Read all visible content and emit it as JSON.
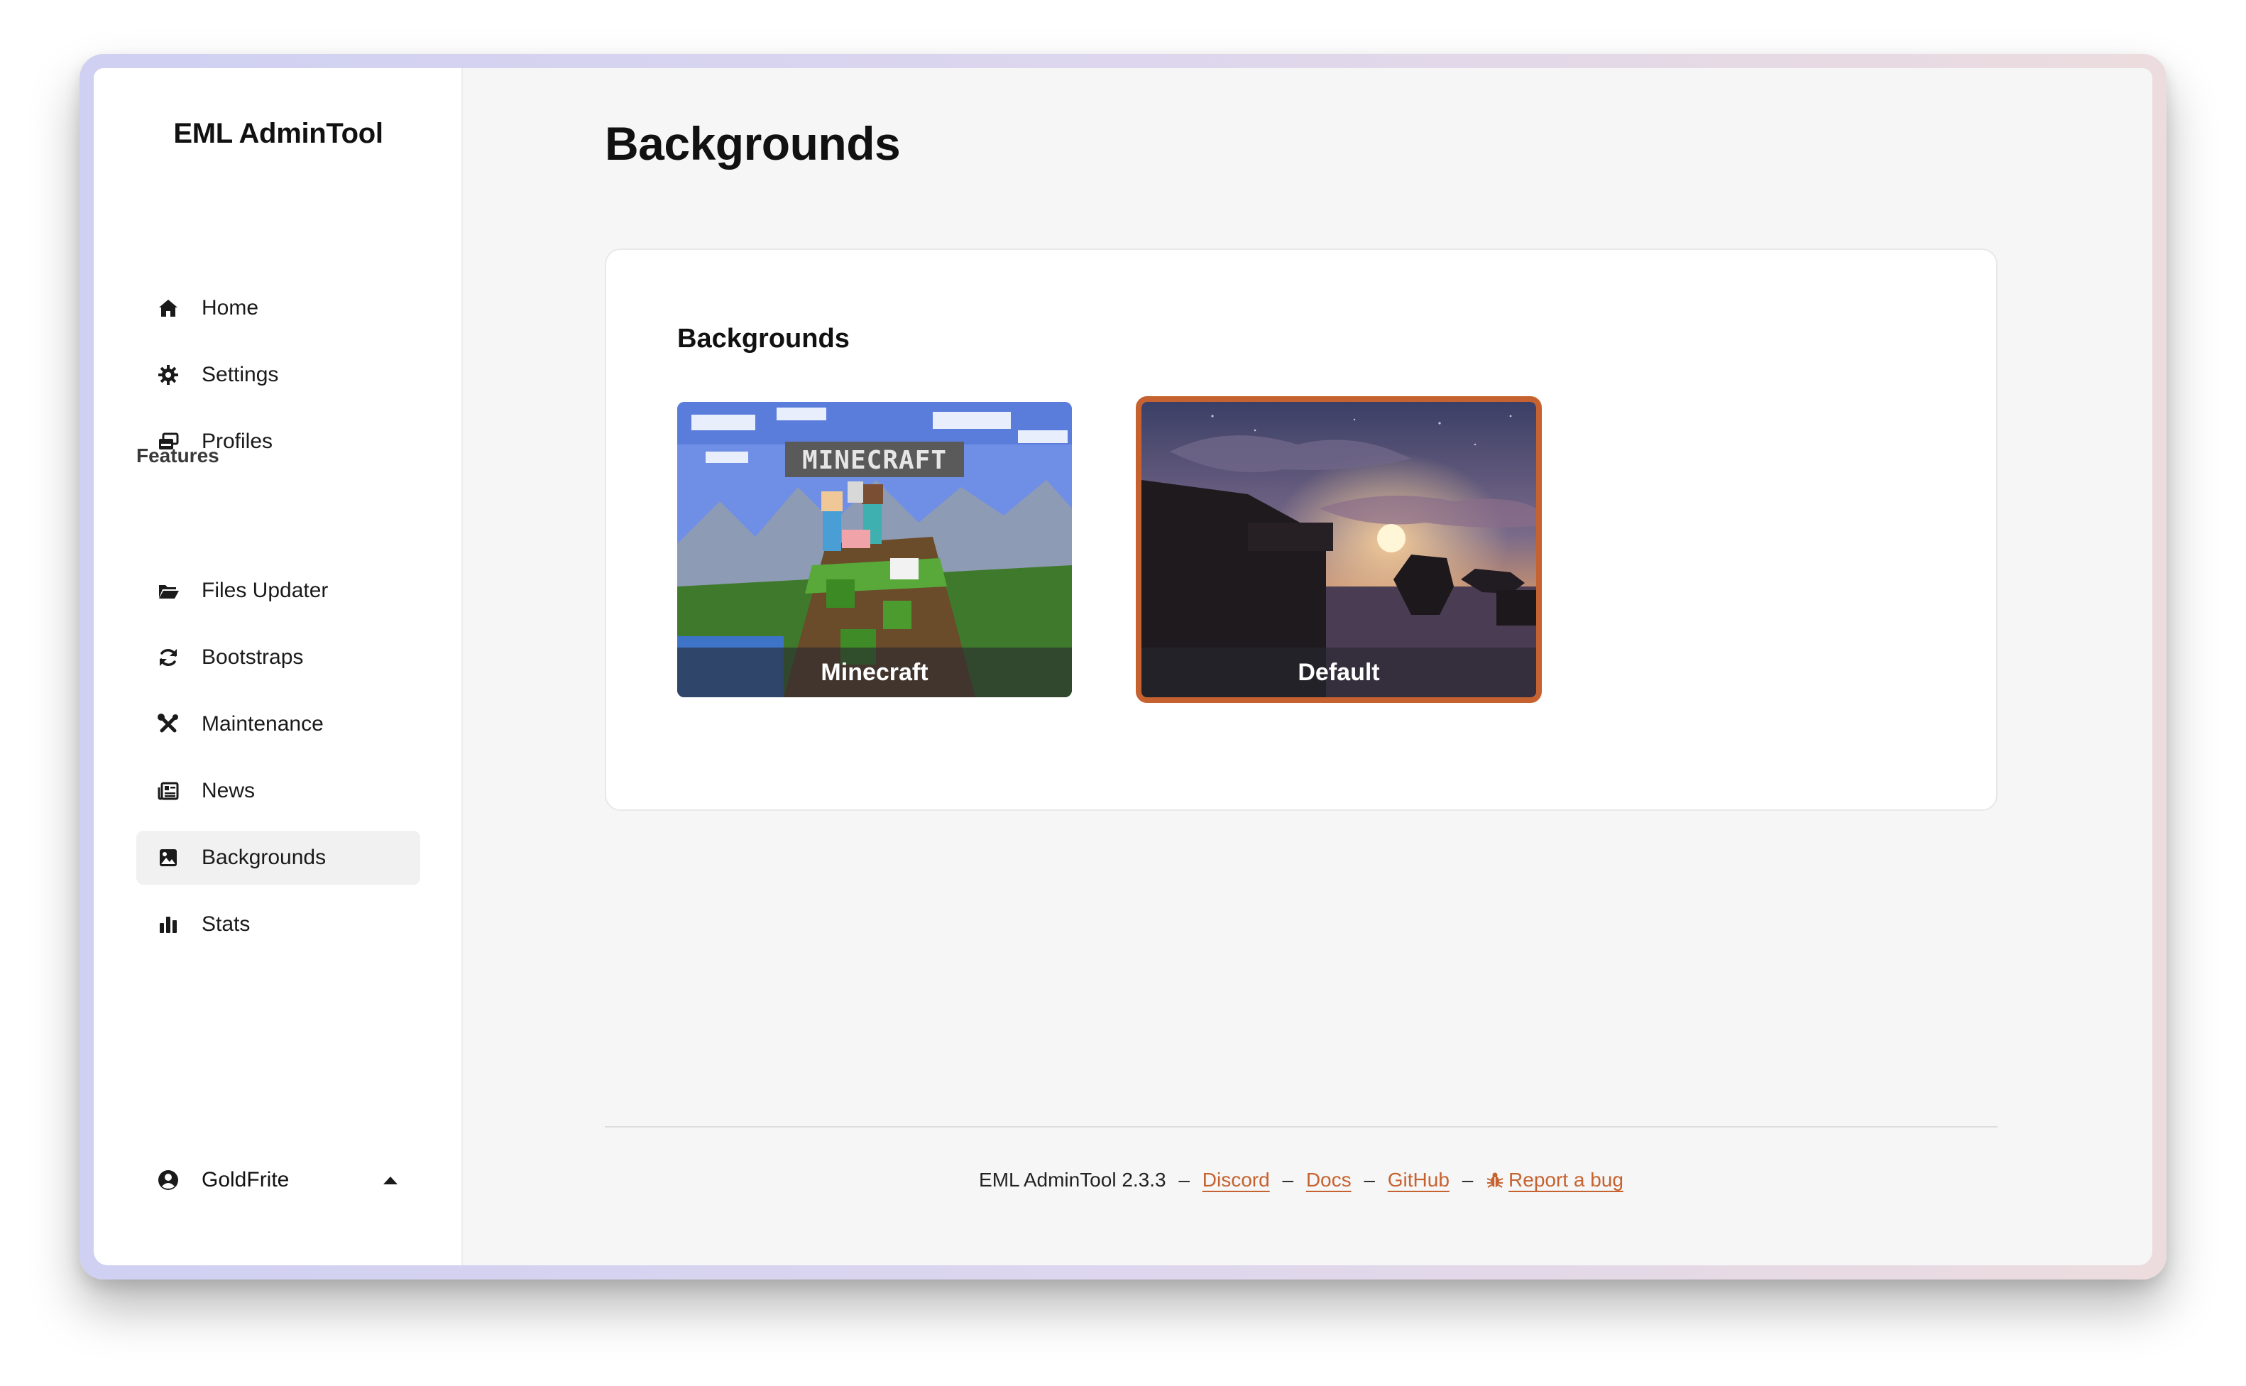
{
  "app": {
    "brand": "EML AdminTool"
  },
  "sidebar": {
    "primary_items": [
      {
        "label": "Home",
        "icon": "home-icon"
      },
      {
        "label": "Settings",
        "icon": "gear-icon"
      },
      {
        "label": "Profiles",
        "icon": "profiles-icon"
      }
    ],
    "section_label": "Features",
    "feature_items": [
      {
        "label": "Files Updater",
        "icon": "folder-open-icon"
      },
      {
        "label": "Bootstraps",
        "icon": "refresh-icon"
      },
      {
        "label": "Maintenance",
        "icon": "tools-icon"
      },
      {
        "label": "News",
        "icon": "newspaper-icon"
      },
      {
        "label": "Backgrounds",
        "icon": "image-icon",
        "active": true
      },
      {
        "label": "Stats",
        "icon": "bar-chart-icon"
      }
    ],
    "user": {
      "name": "GoldFrite",
      "icon": "user-circle-icon",
      "toggle_icon": "caret-up-icon"
    }
  },
  "main": {
    "page_title": "Backgrounds",
    "card": {
      "title": "Backgrounds",
      "backgrounds": [
        {
          "label": "Minecraft",
          "selected": false,
          "logo_text": "MINECRAFT"
        },
        {
          "label": "Default",
          "selected": true
        }
      ]
    }
  },
  "footer": {
    "version_text": "EML AdminTool 2.3.3",
    "separator": "–",
    "links": {
      "discord": "Discord",
      "docs": "Docs",
      "github": "GitHub",
      "report_bug": "Report a bug"
    }
  },
  "colors": {
    "accent": "#c6622f",
    "sidebar_bg": "#ffffff",
    "main_bg": "#f6f6f6",
    "active_item_bg": "#f1f1f1"
  }
}
